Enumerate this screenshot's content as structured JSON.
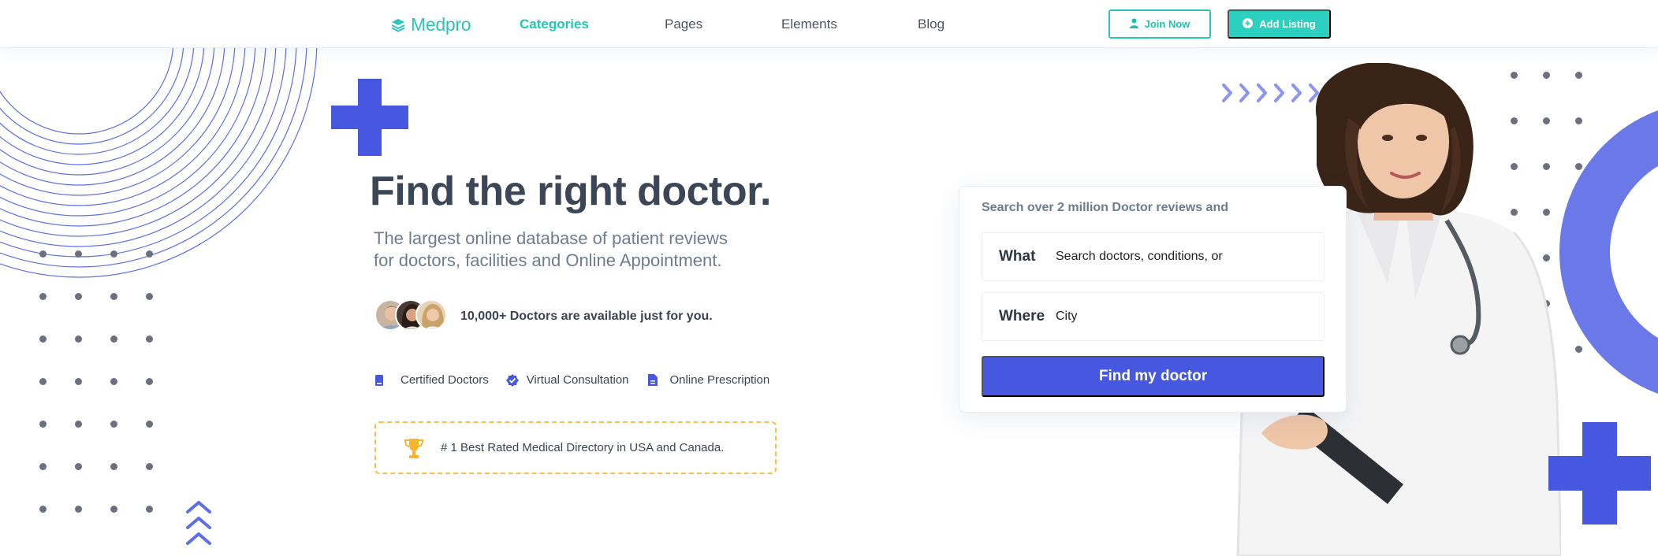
{
  "brand": {
    "name": "Medpro",
    "color": "#2ac4bd"
  },
  "nav": {
    "items": [
      {
        "label": "Categories",
        "active": true
      },
      {
        "label": "Pages",
        "active": false
      },
      {
        "label": "Elements",
        "active": false
      },
      {
        "label": "Blog",
        "active": false
      }
    ],
    "join_label": "Join Now",
    "add_label": "Add Listing"
  },
  "hero": {
    "title": "Find the right doctor.",
    "subtitle_line1": "The largest online database of patient reviews",
    "subtitle_line2": "for doctors, facilities and Online Appointment.",
    "available_text": "10,000+ Doctors are available just for you.",
    "features": [
      {
        "label": "Certified Doctors",
        "icon": "badge-icon"
      },
      {
        "label": "Virtual Consultation",
        "icon": "check-circle-icon"
      },
      {
        "label": "Online Prescription",
        "icon": "document-icon"
      }
    ],
    "award_text": "# 1 Best Rated Medical Directory in USA and Canada."
  },
  "search": {
    "heading": "Search over 2 million Doctor reviews and",
    "what_label": "What",
    "what_placeholder": "Search doctors, conditions, or",
    "where_label": "Where",
    "where_placeholder": "City",
    "button_label": "Find my doctor"
  },
  "colors": {
    "accent": "#4758e0",
    "teal": "#2cd0c0",
    "award_border": "#f5c04a",
    "decor_blue": "#5d6fe6"
  }
}
